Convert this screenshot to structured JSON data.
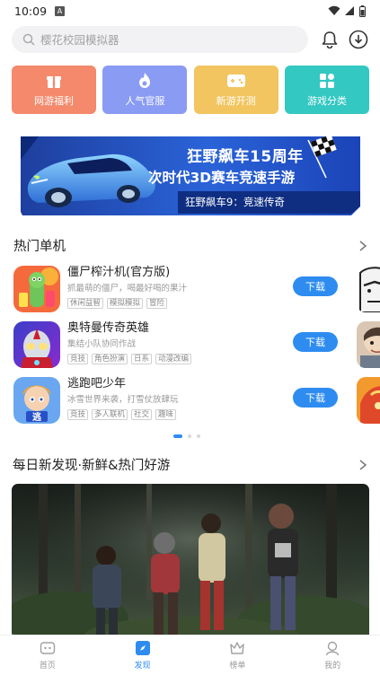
{
  "status_bar": {
    "time": "10:09",
    "notif_badge": "A",
    "icons": [
      "wifi-icon",
      "signal-icon",
      "battery-icon"
    ]
  },
  "search": {
    "placeholder": "樱花校园模拟器",
    "icons": [
      "search-icon",
      "bell-icon",
      "download-icon"
    ]
  },
  "categories": [
    {
      "label": "网游福利",
      "color": "#f4896b",
      "icon": "gift-icon"
    },
    {
      "label": "人气官服",
      "color": "#8a9bf3",
      "icon": "flame-icon"
    },
    {
      "label": "新游开测",
      "color": "#f2c560",
      "icon": "gamepad-icon"
    },
    {
      "label": "游戏分类",
      "color": "#33c8c2",
      "icon": "grid-icon"
    }
  ],
  "banner": {
    "line1": "狂野飙车15周年",
    "line2": "次时代3D赛车竞速手游",
    "caption": "狂野飙车9：竞速传奇"
  },
  "section_hot": {
    "title": "热门单机"
  },
  "games": [
    {
      "name": "僵尸榨汁机(官方版)",
      "desc": "抓最萌的僵尸，喝最好喝的果汁",
      "tags": [
        "休闲益智",
        "模拟模拟",
        "冒险"
      ],
      "button": "下载"
    },
    {
      "name": "奥特曼传奇英雄",
      "desc": "集结小队协同作战",
      "tags": [
        "竞技",
        "角色扮演",
        "日系",
        "动漫改编"
      ],
      "button": "下载"
    },
    {
      "name": "逃跑吧少年",
      "desc": "冰雪世界来袭，打雪仗放肆玩",
      "tags": [
        "竞技",
        "多人联机",
        "社交",
        "趣味"
      ],
      "button": "下载"
    }
  ],
  "section_daily": {
    "title": "每日新发现·新鲜&热门好游"
  },
  "tabbar": [
    {
      "label": "首页",
      "icon": "home-icon",
      "active": false
    },
    {
      "label": "发现",
      "icon": "discover-icon",
      "active": true
    },
    {
      "label": "榜单",
      "icon": "crown-icon",
      "active": false
    },
    {
      "label": "我的",
      "icon": "user-icon",
      "active": false
    }
  ],
  "colors": {
    "accent": "#2e8cf0",
    "text": "#222222",
    "muted": "#9a9a9a"
  }
}
